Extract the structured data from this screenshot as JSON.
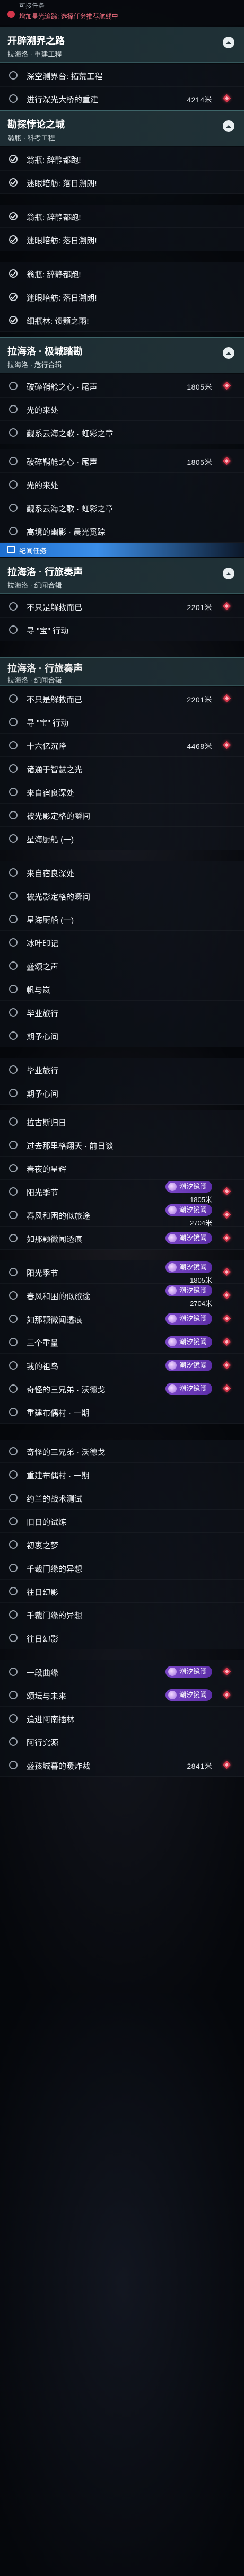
{
  "top_notice": {
    "line1": "可接任务",
    "line2": "增加星光追踪: 选择任务推荐航线中"
  },
  "chapters": [
    {
      "title": "开辟溯界之路",
      "subtitle": "拉海洛 · 重建工程"
    },
    {
      "title": "勘探悖论之城",
      "subtitle": "翁瓶 · 科考工程"
    },
    {
      "title": "拉海洛 · 极城踏勘",
      "subtitle": "拉海洛 · 危行合辑"
    },
    {
      "title": "拉海洛 · 行旅奏声",
      "subtitle": "拉海洛 · 纪闻合辑"
    }
  ],
  "banner": {
    "label": "纪闻任务"
  },
  "rows": [
    {
      "text": "深空测界台: 拓荒工程",
      "state": "empty"
    },
    {
      "text": "迸行深光大桥的重建",
      "state": "empty",
      "dist": "4214米"
    },
    {
      "text": "翁瓶: 辞静都跑!",
      "state": "done"
    },
    {
      "text": "迷眼培舫: 落日溯朗!",
      "state": "done"
    },
    {
      "text": "翁瓶: 辞静都跑!",
      "state": "done"
    },
    {
      "text": "迷眼培舫: 落日溯朗!",
      "state": "done"
    },
    {
      "text": "翁瓶: 辞静都跑!",
      "state": "done"
    },
    {
      "text": "迷眼培舫: 落日溯朗!",
      "state": "done"
    },
    {
      "text": "细瓶林: 馈颢之雨!",
      "state": "done"
    },
    {
      "text": "破碎鞘舱之心 · 尾声",
      "state": "empty",
      "dist": "1805米"
    },
    {
      "text": "光的来处",
      "state": "empty"
    },
    {
      "text": "觐系云海之歌 · 虹彩之章",
      "state": "empty"
    },
    {
      "text": "破碎鞘舱之心 · 尾声",
      "state": "empty",
      "dist": "1805米"
    },
    {
      "text": "光的来处",
      "state": "empty"
    },
    {
      "text": "觐系云海之歌 · 虹彩之章",
      "state": "empty"
    },
    {
      "text": "高境的幽影 · 晨光觅踪",
      "state": "empty"
    },
    {
      "text": "不只是解救而已",
      "state": "empty",
      "dist": "2201米"
    },
    {
      "text": "寻 \"宝\" 行动",
      "state": "empty"
    },
    {
      "text": "不只是解救而已",
      "state": "empty",
      "dist": "2201米"
    },
    {
      "text": "寻 \"宝\" 行动",
      "state": "empty"
    },
    {
      "text": "十六亿沉降",
      "state": "empty",
      "dist": "4468米"
    },
    {
      "text": "诸通于智慧之光",
      "state": "empty"
    },
    {
      "text": "来自宿良深处",
      "state": "empty"
    },
    {
      "text": "被光影定格的瞬间",
      "state": "empty"
    },
    {
      "text": "星海厨船 (一)",
      "state": "empty"
    },
    {
      "text": "来自宿良深处",
      "state": "empty"
    },
    {
      "text": "被光影定格的瞬间",
      "state": "empty"
    },
    {
      "text": "星海厨船 (一)",
      "state": "empty"
    },
    {
      "text": "冰叶印记",
      "state": "empty"
    },
    {
      "text": "盛颂之声",
      "state": "empty"
    },
    {
      "text": "帆与岚",
      "state": "empty"
    },
    {
      "text": "毕业旅行",
      "state": "empty"
    },
    {
      "text": "期予心间",
      "state": "empty"
    },
    {
      "text": "毕业旅行",
      "state": "empty"
    },
    {
      "text": "期予心间",
      "state": "empty"
    },
    {
      "text": "拉古斯归日",
      "state": "empty"
    },
    {
      "text": "过去那里格翔天 · 前日谈",
      "state": "empty"
    },
    {
      "text": "春夜的星辉",
      "state": "empty"
    },
    {
      "text": "阳光季节",
      "state": "empty",
      "badge": "潮汐镜阈",
      "dist": "1805米"
    },
    {
      "text": "春风和困的似旅途",
      "state": "empty",
      "badge": "潮汐镜阈",
      "dist": "2704米"
    },
    {
      "text": "如那颗微闻透痕",
      "state": "empty",
      "badge": "潮汐镜阈"
    },
    {
      "text": "阳光季节",
      "state": "empty",
      "badge": "潮汐镜阈",
      "dist": "1805米"
    },
    {
      "text": "春风和困的似旅途",
      "state": "empty",
      "badge": "潮汐镜阈",
      "dist": "2704米"
    },
    {
      "text": "如那颗微闻透痕",
      "state": "empty",
      "badge": "潮汐镜阈"
    },
    {
      "text": "三个重量",
      "state": "empty",
      "badge": "潮汐镜阈"
    },
    {
      "text": "我的祖鸟",
      "state": "empty",
      "badge": "潮汐镜阈"
    },
    {
      "text": "奇怪的三兄弟 · 沃德戈",
      "state": "empty",
      "badge": "潮汐镜阈"
    },
    {
      "text": "重建布偶村 · 一期",
      "state": "empty"
    },
    {
      "text": "奇怪的三兄弟 · 沃德戈",
      "state": "empty"
    },
    {
      "text": "重建布偶村 · 一期",
      "state": "empty"
    },
    {
      "text": "约兰的战术测试",
      "state": "empty"
    },
    {
      "text": "旧日的试炼",
      "state": "empty"
    },
    {
      "text": "初衷之梦",
      "state": "empty"
    },
    {
      "text": "千裁门缘的异想",
      "state": "empty"
    },
    {
      "text": "往日幻影",
      "state": "empty"
    },
    {
      "text": "千裁门缘的异想",
      "state": "empty"
    },
    {
      "text": "往日幻影",
      "state": "empty"
    },
    {
      "text": "一段曲缘",
      "state": "empty",
      "badge": "潮汐镜阈"
    },
    {
      "text": "颂坛与未来",
      "state": "empty",
      "badge": "潮汐镜阈"
    },
    {
      "text": "追进阿南插林",
      "state": "empty"
    },
    {
      "text": "阿行究源",
      "state": "empty"
    },
    {
      "text": "盛孩城暮的暖炸裁",
      "state": "empty",
      "dist": "2841米"
    }
  ],
  "colors": {
    "accent_red": "#d4364b",
    "badge_purple": "#7a46c7",
    "header_teal": "#22343a",
    "banner_blue": "#1d6fd0"
  }
}
